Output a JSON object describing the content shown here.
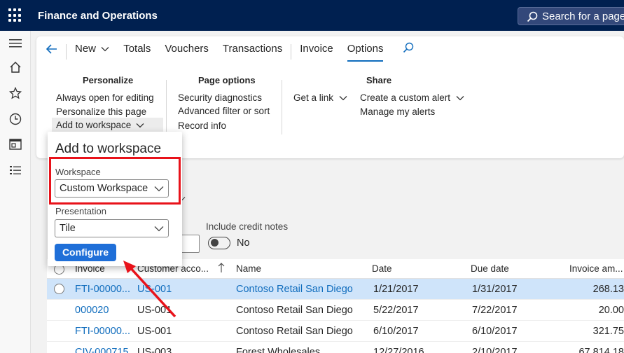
{
  "app": {
    "title": "Finance and Operations",
    "search_placeholder": "Search for a page"
  },
  "tabs": [
    {
      "label": "New"
    },
    {
      "label": "Totals"
    },
    {
      "label": "Vouchers"
    },
    {
      "label": "Transactions"
    },
    {
      "label": "Invoice"
    },
    {
      "label": "Options"
    }
  ],
  "ribbon": {
    "personalize": {
      "title": "Personalize",
      "items": [
        "Always open for editing",
        "Personalize this page",
        "Add to workspace"
      ]
    },
    "page_options": {
      "title": "Page options",
      "items": [
        "Security diagnostics",
        "Advanced filter or sort",
        "Record info"
      ]
    },
    "share": {
      "title": "Share",
      "get_link": "Get a link",
      "create_alert": "Create a custom alert",
      "manage_alerts": "Manage my alerts"
    }
  },
  "popup": {
    "title": "Add to workspace",
    "workspace_label": "Workspace",
    "workspace_value": "Custom Workspace",
    "presentation_label": "Presentation",
    "presentation_value": "Tile",
    "configure_label": "Configure"
  },
  "filters": {
    "credit_notes_label": "Include credit notes",
    "credit_notes_value": "No"
  },
  "grid": {
    "headers": [
      "Invoice",
      "Customer acco...",
      "Name",
      "Date",
      "Due date",
      "Invoice am..."
    ],
    "rows": [
      [
        "FTI-00000...",
        "US-001",
        "Contoso Retail San Diego",
        "1/21/2017",
        "1/31/2017",
        "268.13"
      ],
      [
        "000020",
        "US-001",
        "Contoso Retail San Diego",
        "5/22/2017",
        "7/22/2017",
        "20.00"
      ],
      [
        "FTI-00000...",
        "US-001",
        "Contoso Retail San Diego",
        "6/10/2017",
        "6/10/2017",
        "321.75"
      ],
      [
        "CIV-000715",
        "US-003",
        "Forest Wholesales",
        "12/27/2016",
        "2/10/2017",
        "67,814.18"
      ]
    ]
  },
  "colors": {
    "topbar": "#002050",
    "accent": "#0f6cbd",
    "highlight_box": "#e8121a",
    "selected_row": "#cfe4fa"
  }
}
